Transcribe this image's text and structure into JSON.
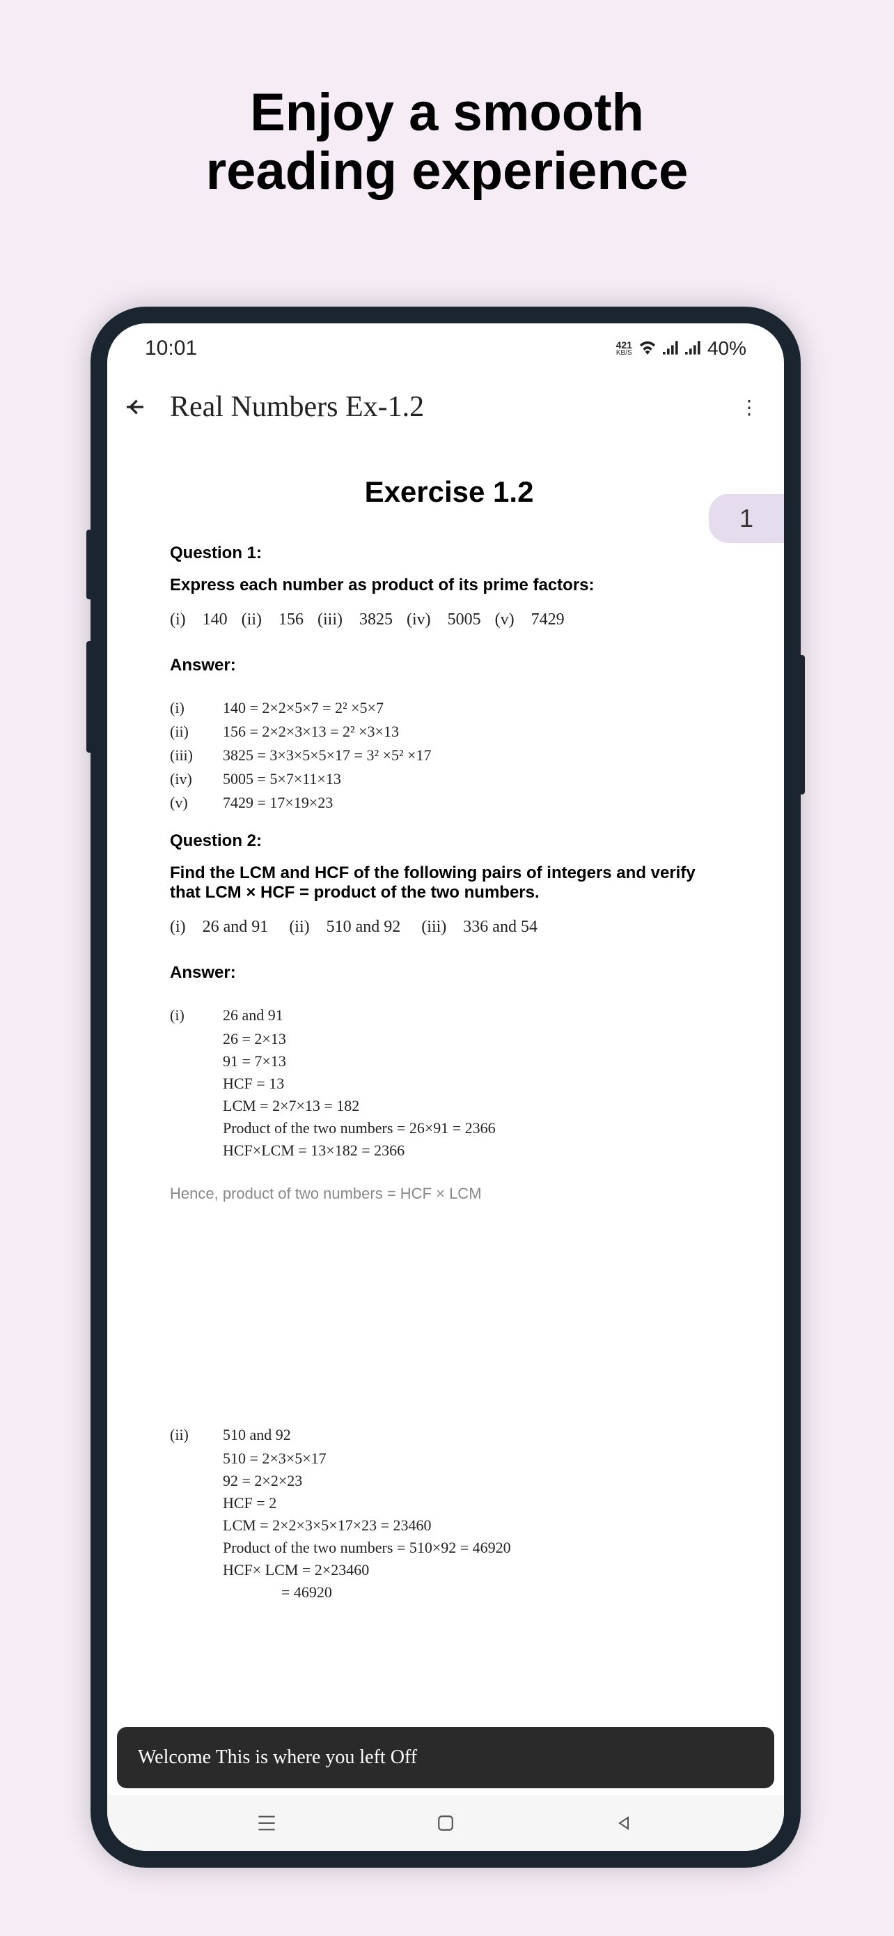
{
  "hero": {
    "line1": "Enjoy a smooth",
    "line2": "reading experience"
  },
  "statusbar": {
    "time": "10:01",
    "speed_top": "421",
    "speed_bottom": "KB/S",
    "battery": "40%"
  },
  "header": {
    "title": "Real Numbers Ex-1.2"
  },
  "page_number": "1",
  "content": {
    "exercise_title": "Exercise 1.2",
    "q1": {
      "label": "Question 1:",
      "text": "Express each number as product of its prime factors:",
      "items": [
        {
          "roman": "(i)",
          "val": "140"
        },
        {
          "roman": "(ii)",
          "val": "156"
        },
        {
          "roman": "(iii)",
          "val": "3825"
        },
        {
          "roman": "(iv)",
          "val": "5005"
        },
        {
          "roman": "(v)",
          "val": "7429"
        }
      ],
      "answer_label": "Answer:",
      "answers": [
        {
          "roman": "(i)",
          "expr": "140 = 2×2×5×7 = 2² ×5×7"
        },
        {
          "roman": "(ii)",
          "expr": "156 = 2×2×3×13 = 2² ×3×13"
        },
        {
          "roman": "(iii)",
          "expr": "3825 = 3×3×5×5×17 = 3² ×5² ×17"
        },
        {
          "roman": "(iv)",
          "expr": "5005 = 5×7×11×13"
        },
        {
          "roman": "(v)",
          "expr": "7429 = 17×19×23"
        }
      ]
    },
    "q2": {
      "label": "Question 2:",
      "text": "Find the LCM and HCF of the following pairs of integers and verify that LCM × HCF = product of the two numbers.",
      "items": [
        {
          "roman": "(i)",
          "val": "26 and 91"
        },
        {
          "roman": "(ii)",
          "val": "510 and 92"
        },
        {
          "roman": "(iii)",
          "val": "336 and 54"
        }
      ],
      "answer_label": "Answer:",
      "part_i": {
        "roman": "(i)",
        "header": "26 and 91",
        "lines": [
          "26 = 2×13",
          "91 = 7×13",
          "HCF = 13",
          "LCM = 2×7×13 = 182",
          "Product of the two numbers = 26×91 = 2366",
          "HCF×LCM = 13×182 = 2366"
        ]
      },
      "note": "Hence, product of two numbers = HCF × LCM",
      "part_ii": {
        "roman": "(ii)",
        "header": "510 and 92",
        "lines": [
          "510 = 2×3×5×17",
          "92 = 2×2×23",
          "HCF = 2",
          "LCM = 2×2×3×5×17×23 = 23460",
          "Product of the two numbers = 510×92 = 46920",
          "HCF× LCM = 2×23460"
        ],
        "cont": "= 46920"
      }
    }
  },
  "toast": "Welcome This is where you left Off"
}
